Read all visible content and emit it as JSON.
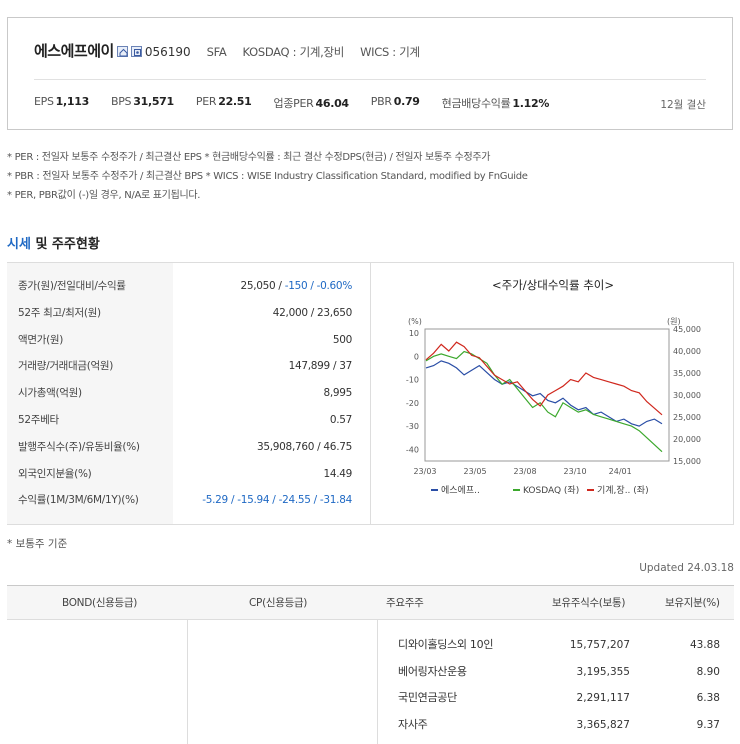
{
  "header": {
    "company_name": "에스에프에이",
    "code": "056190",
    "ticker": "SFA",
    "market": "KOSDAQ : 기계,장비",
    "wics": "WICS : 기계",
    "stats": [
      {
        "label": "EPS",
        "value": "1,113"
      },
      {
        "label": "BPS",
        "value": "31,571"
      },
      {
        "label": "PER",
        "value": "22.51"
      },
      {
        "label": "업종PER",
        "value": "46.04"
      },
      {
        "label": "PBR",
        "value": "0.79"
      },
      {
        "label": "현금배당수익률",
        "value": "1.12%"
      }
    ],
    "settlement": "12월 결산"
  },
  "notes": [
    "* PER : 전일자 보통주 수정주가 / 최근결산 EPS * 현금배당수익률 : 최근 결산 수정DPS(현금) / 전일자 보통주 수정주가",
    "* PBR : 전일자 보통주 수정주가 / 최근결산 BPS * WICS : WISE Industry Classification Standard, modified by FnGuide",
    "* PER, PBR값이 (-)일 경우, N/A로 표기됩니다."
  ],
  "section": {
    "title_accent": "시세",
    "title_rest": " 및 주주현황"
  },
  "price_rows": [
    {
      "label": "종가(원)/전일대비/수익률",
      "value": "25,050 / ",
      "blue": "-150 / -0.60%"
    },
    {
      "label": "52주 최고/최저(원)",
      "value": "42,000 / 23,650",
      "blue": ""
    },
    {
      "label": "액면가(원)",
      "value": "500",
      "blue": ""
    },
    {
      "label": "거래량/거래대금(억원)",
      "value": "147,899 / 37",
      "blue": ""
    },
    {
      "label": "시가총액(억원)",
      "value": "8,995",
      "blue": ""
    },
    {
      "label": "52주베타",
      "value": "0.57",
      "blue": ""
    },
    {
      "label": "발행주식수(주)/유동비율(%)",
      "value": "35,908,760 / 46.75",
      "blue": ""
    },
    {
      "label": "외국인지분율(%)",
      "value": "14.49",
      "blue": ""
    },
    {
      "label": "수익률(1M/3M/6M/1Y)(%)",
      "value": "",
      "blue": "-5.29 / -15.94 / -24.55 / -31.84"
    }
  ],
  "chart_data": {
    "type": "line",
    "title": "<주가/상대수익률 추이>",
    "left_unit": "(%)",
    "right_unit": "(원)",
    "y_left_ticks": [
      "10",
      "0",
      "-10",
      "-20",
      "-30",
      "-40"
    ],
    "y_left_range": [
      -45,
      10
    ],
    "y_right_ticks": [
      "45,000",
      "40,000",
      "35,000",
      "30,000",
      "25,000",
      "20,000",
      "15,000"
    ],
    "y_right_range": [
      15000,
      45000
    ],
    "x_ticks": [
      "23/03",
      "23/05",
      "23/08",
      "23/10",
      "24/01"
    ],
    "series": [
      {
        "name": "에스에프..",
        "axis": "left",
        "color": "#2a4ea6",
        "values": [
          -5,
          -4,
          -2,
          -3,
          -5,
          -8,
          -6,
          -4,
          -7,
          -10,
          -12,
          -11,
          -13,
          -15,
          -17,
          -16,
          -19,
          -20,
          -18,
          -21,
          -23,
          -22,
          -25,
          -24,
          -26,
          -28,
          -27,
          -29,
          -30,
          -28,
          -27,
          -29
        ]
      },
      {
        "name": "KOSDAQ (좌)",
        "axis": "left",
        "color": "#3ca82d",
        "values": [
          -2,
          0,
          1,
          0,
          -1,
          2,
          1,
          -1,
          -3,
          -8,
          -12,
          -10,
          -14,
          -18,
          -22,
          -20,
          -24,
          -26,
          -20,
          -22,
          -24,
          -23,
          -25,
          -26,
          -27,
          -28,
          -29,
          -30,
          -32,
          -35,
          -38,
          -41
        ]
      },
      {
        "name": "기계,장.. (좌)",
        "axis": "right",
        "color": "#d0281e",
        "values": [
          38000,
          39500,
          41500,
          40000,
          42000,
          41000,
          39000,
          38500,
          36500,
          34500,
          33500,
          32500,
          33000,
          31000,
          29000,
          27500,
          30000,
          31000,
          32000,
          33500,
          33000,
          35000,
          34000,
          33500,
          33000,
          32500,
          32000,
          31000,
          30500,
          28500,
          27000,
          25500
        ]
      }
    ]
  },
  "note2": "* 보통주 기준",
  "updated": "Updated 24.03.18",
  "bottom": {
    "headers": {
      "bond": "BOND(신용등급)",
      "cp": "CP(신용등급)",
      "holder": "주요주주",
      "shares": "보유주식수(보통)",
      "ratio": "보유지분(%)"
    },
    "holders": [
      {
        "name": "디와이홀딩스외 10인",
        "shares": "15,757,207",
        "ratio": "43.88"
      },
      {
        "name": "베어링자산운용",
        "shares": "3,195,355",
        "ratio": "8.90"
      },
      {
        "name": "국민연금공단",
        "shares": "2,291,117",
        "ratio": "6.38"
      },
      {
        "name": "자사주",
        "shares": "3,365,827",
        "ratio": "9.37"
      }
    ]
  }
}
